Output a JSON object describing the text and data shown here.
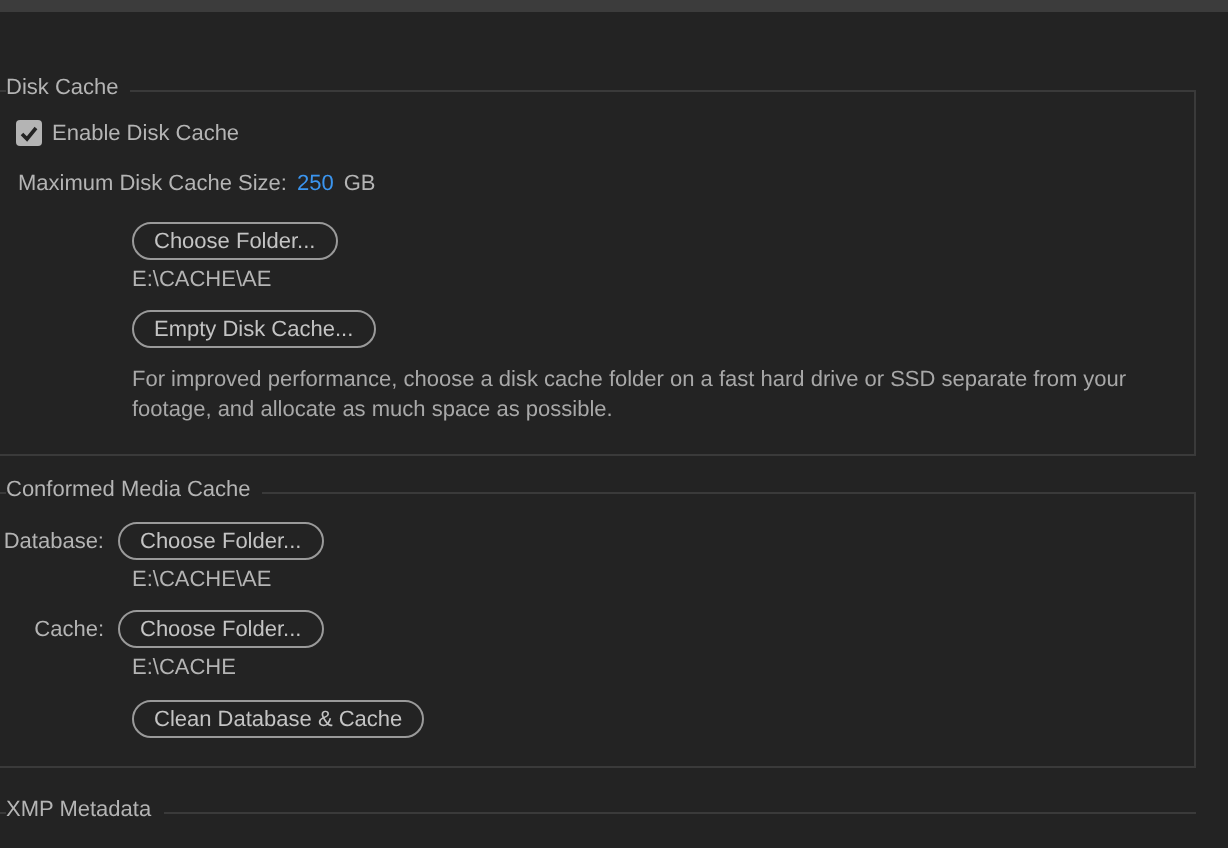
{
  "disk_cache": {
    "title": "Disk Cache",
    "enable": {
      "label": "Enable Disk Cache",
      "checked": true
    },
    "max_size": {
      "label": "Maximum Disk Cache Size:",
      "value": "250",
      "unit": "GB"
    },
    "choose_button": "Choose Folder...",
    "path": "E:\\CACHE\\AE",
    "empty_button": "Empty Disk Cache...",
    "description": "For improved performance, choose a disk cache folder on a fast hard drive or SSD separate from your footage, and allocate as much space as possible."
  },
  "conformed_media_cache": {
    "title": "Conformed Media Cache",
    "rows": [
      {
        "label": "Database:",
        "button": "Choose Folder...",
        "path": "E:\\CACHE\\AE"
      },
      {
        "label": "Cache:",
        "button": "Choose Folder...",
        "path": "E:\\CACHE"
      }
    ],
    "clean_button": "Clean Database & Cache"
  },
  "xmp_metadata": {
    "title": "XMP Metadata"
  }
}
